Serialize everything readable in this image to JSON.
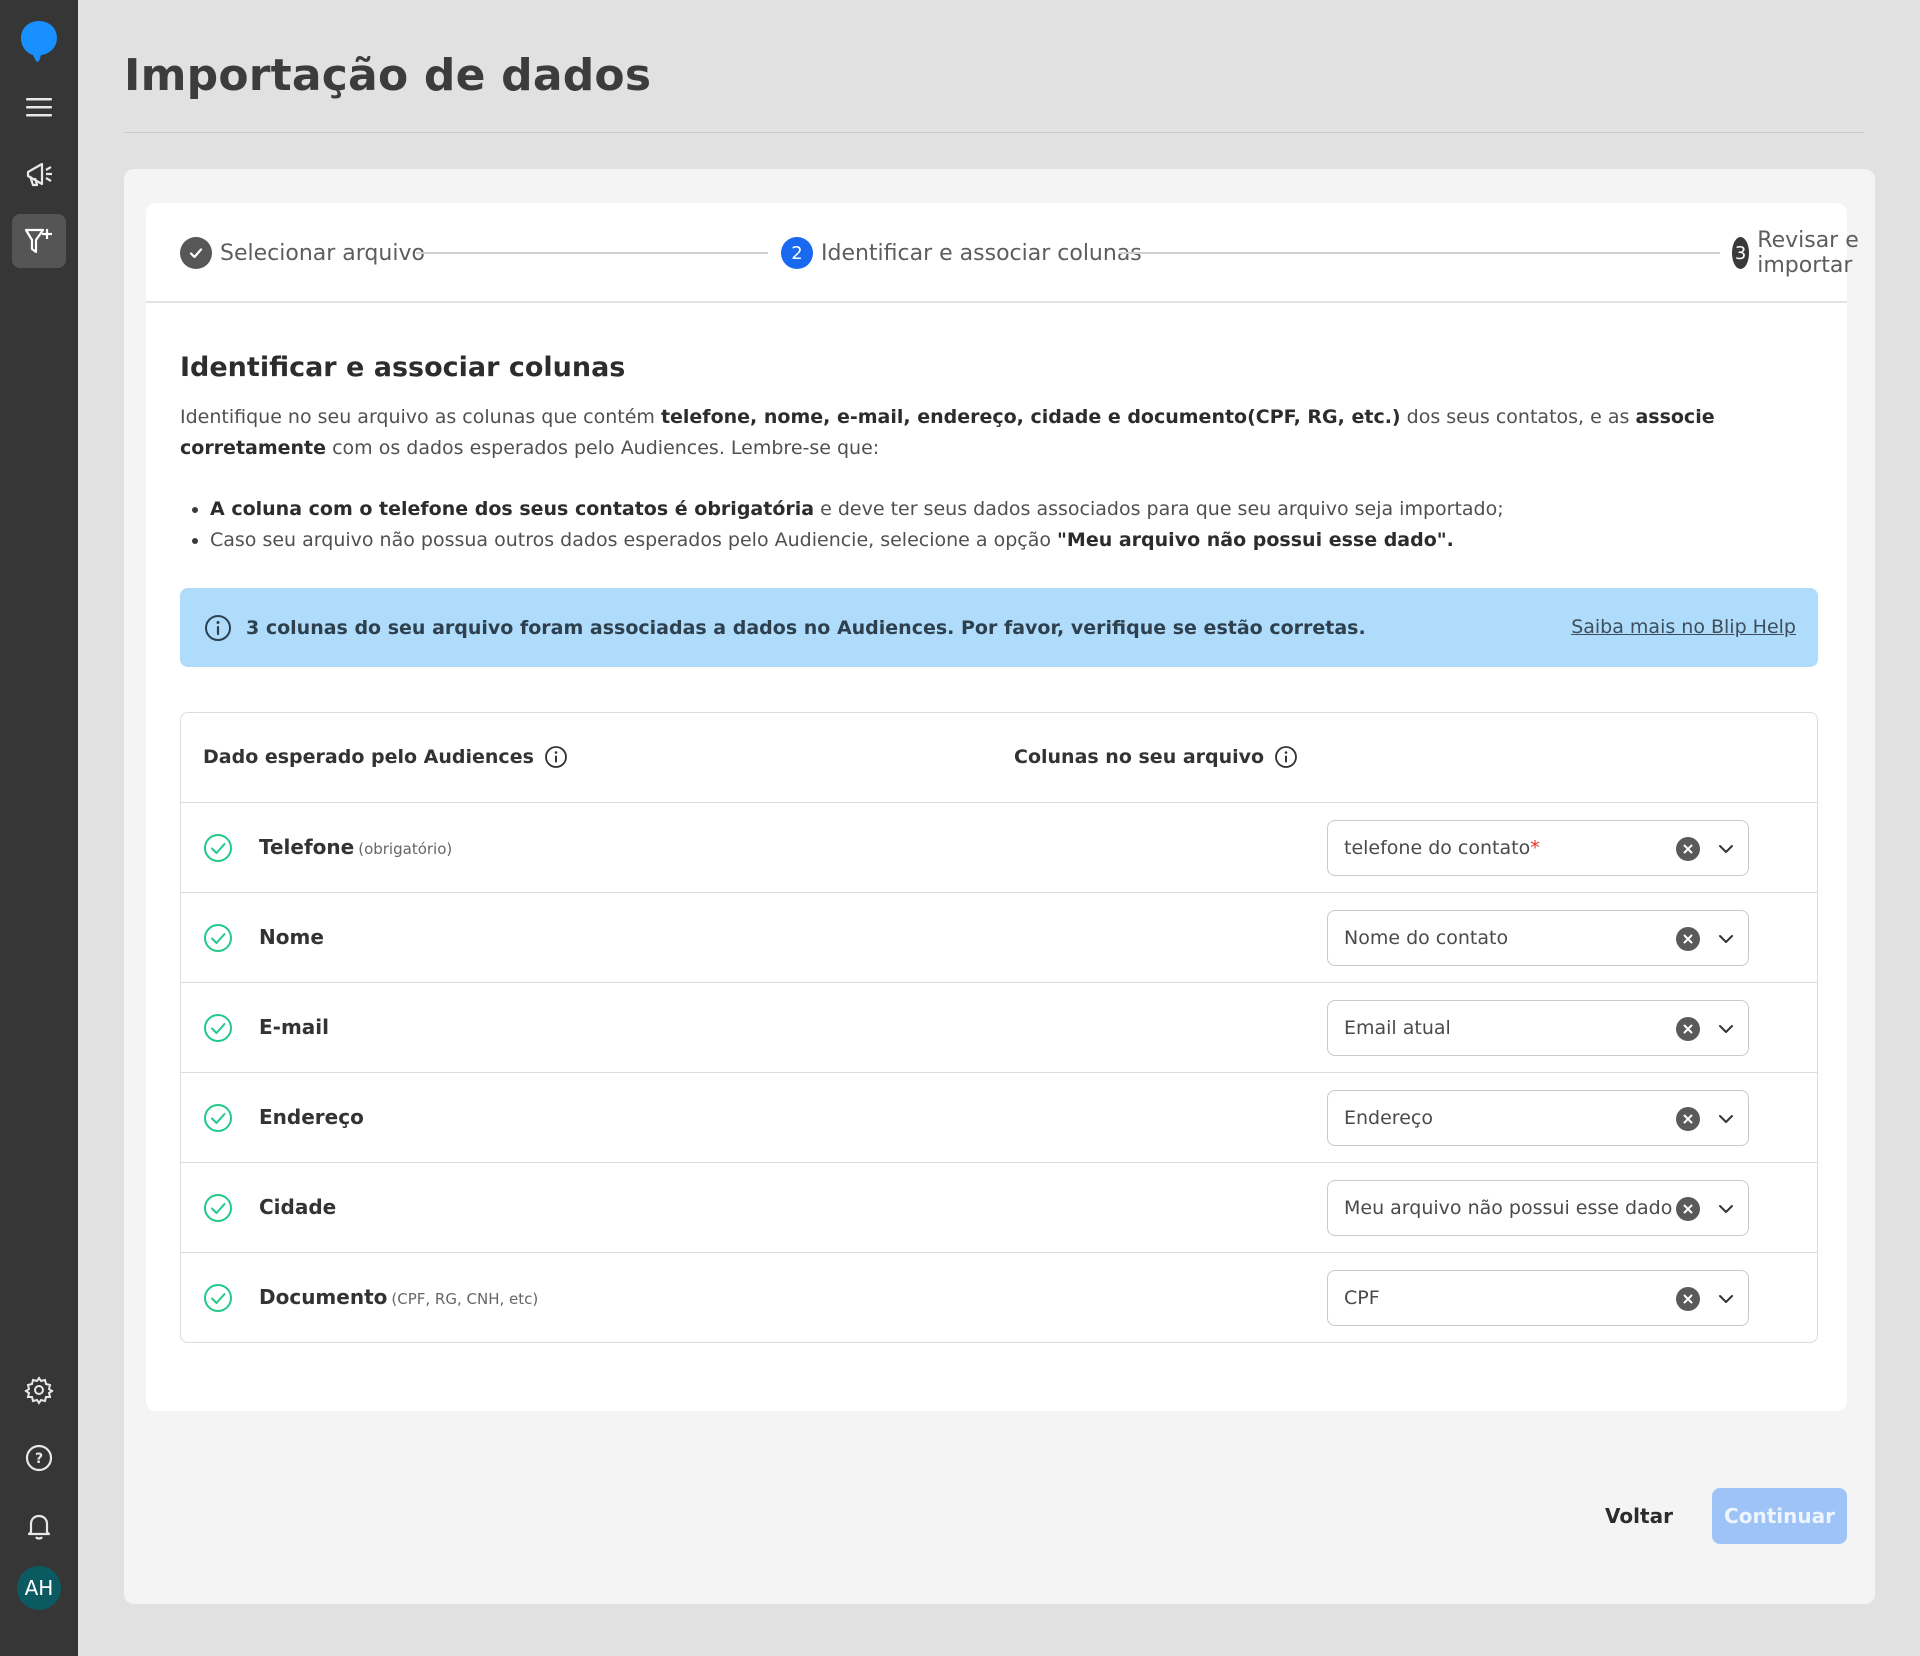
{
  "sidebar": {
    "logo_icon": "blip-chat-bubble-icon",
    "items": [
      {
        "icon": "menu-icon"
      },
      {
        "icon": "megaphone-icon"
      },
      {
        "icon": "filter-plus-icon",
        "active": true
      }
    ],
    "bottom_items": [
      {
        "icon": "gear-icon"
      },
      {
        "icon": "help-icon"
      },
      {
        "icon": "bell-icon"
      }
    ],
    "avatar_initials": "AH",
    "colors": {
      "background": "#363636",
      "logo": "#1890ff",
      "avatar": "#0b5a62"
    }
  },
  "header": {
    "title": "Importação de dados"
  },
  "stepper": {
    "steps": [
      {
        "number": "",
        "label": "Selecionar arquivo",
        "status": "completed"
      },
      {
        "number": "2",
        "label": "Identificar e associar colunas",
        "status": "current"
      },
      {
        "number": "3",
        "label": "Revisar e importar",
        "status": "pending"
      }
    ],
    "colors": {
      "completed": "#575757",
      "current": "#1968f0",
      "pending": "#3a3a3a"
    }
  },
  "section": {
    "title": "Identificar e associar colunas",
    "desc_part1": "Identifique no seu arquivo as colunas que contém ",
    "desc_bold1": "telefone, nome, e-mail, endereço, cidade e documento(CPF, RG, etc.)",
    "desc_part2": " dos seus contatos, e as ",
    "desc_bold2": "associe corretamente",
    "desc_part3": " com os dados esperados pelo Audiences. Lembre-se que:",
    "bullet1_bold": "A coluna com o telefone dos seus contatos é obrigatória",
    "bullet1_rest": " e deve ter seus dados associados para que seu arquivo seja importado;",
    "bullet2_rest": "Caso seu arquivo não possua outros dados esperados pelo Audiencie, selecione a opção ",
    "bullet2_bold": "\"Meu arquivo não possui esse dado\"."
  },
  "banner": {
    "icon": "info-icon",
    "text": "3 colunas do seu arquivo foram associadas a dados no Audiences. Por favor, verifique se estão corretas.",
    "link": "Saiba mais no Blip Help",
    "color": "#b0dcfb"
  },
  "table": {
    "col_expected": "Dado esperado pelo Audiences",
    "col_file": "Colunas no seu arquivo",
    "rows": [
      {
        "label": "Telefone",
        "hint": "(obrigatório)",
        "value": "telefone do contato",
        "required_marker": "*"
      },
      {
        "label": "Nome",
        "hint": "",
        "value": "Nome do contato",
        "required_marker": ""
      },
      {
        "label": "E-mail",
        "hint": "",
        "value": "Email atual",
        "required_marker": ""
      },
      {
        "label": "Endereço",
        "hint": "",
        "value": "Endereço",
        "required_marker": ""
      },
      {
        "label": "Cidade",
        "hint": "",
        "value": "Meu arquivo não possui esse dado",
        "required_marker": ""
      },
      {
        "label": "Documento",
        "hint": "(CPF, RG, CNH, etc)",
        "value": "CPF",
        "required_marker": ""
      }
    ],
    "check_color": "#21c98a"
  },
  "footer": {
    "back_label": "Voltar",
    "continue_label": "Continuar",
    "continue_color": "#9dc3f7"
  }
}
